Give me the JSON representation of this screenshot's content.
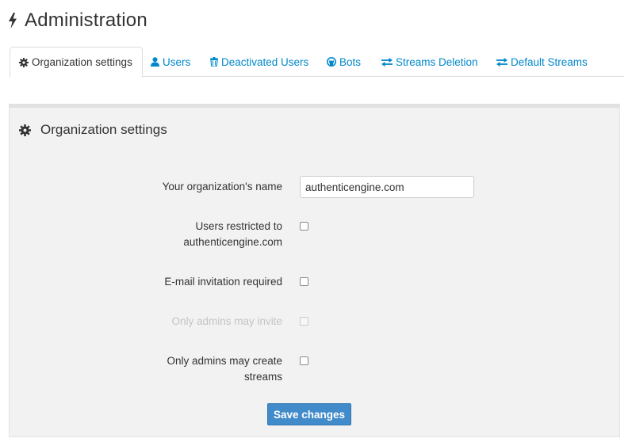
{
  "header": {
    "title": "Administration",
    "icon": "bolt-icon"
  },
  "tabs": [
    {
      "label": "Organization settings",
      "icon": "gear-icon",
      "active": true
    },
    {
      "label": "Users",
      "icon": "user-icon",
      "active": false
    },
    {
      "label": "Deactivated Users",
      "icon": "trash-icon",
      "active": false
    },
    {
      "label": "Bots",
      "icon": "github-icon",
      "active": false
    },
    {
      "label": "Streams Deletion",
      "icon": "exchange-icon",
      "active": false
    },
    {
      "label": "Default Streams",
      "icon": "exchange-icon",
      "active": false
    }
  ],
  "panel": {
    "title": "Organization settings",
    "icon": "gear-icon",
    "fields": {
      "org_name": {
        "label": "Your organization's name",
        "value": "authenticengine.com"
      },
      "restricted": {
        "label_line1": "Users restricted to",
        "label_line2": "authenticengine.com",
        "checked": false
      },
      "email_invite": {
        "label": "E-mail invitation required",
        "checked": false
      },
      "admins_invite": {
        "label": "Only admins may invite",
        "checked": false,
        "disabled": true
      },
      "admins_streams": {
        "label_line1": "Only admins may create",
        "label_line2": "streams",
        "checked": false
      }
    },
    "save_label": "Save changes"
  },
  "colors": {
    "link": "#0088cc",
    "primary_button": "#428bca",
    "panel_bg": "#f2f2f2"
  }
}
